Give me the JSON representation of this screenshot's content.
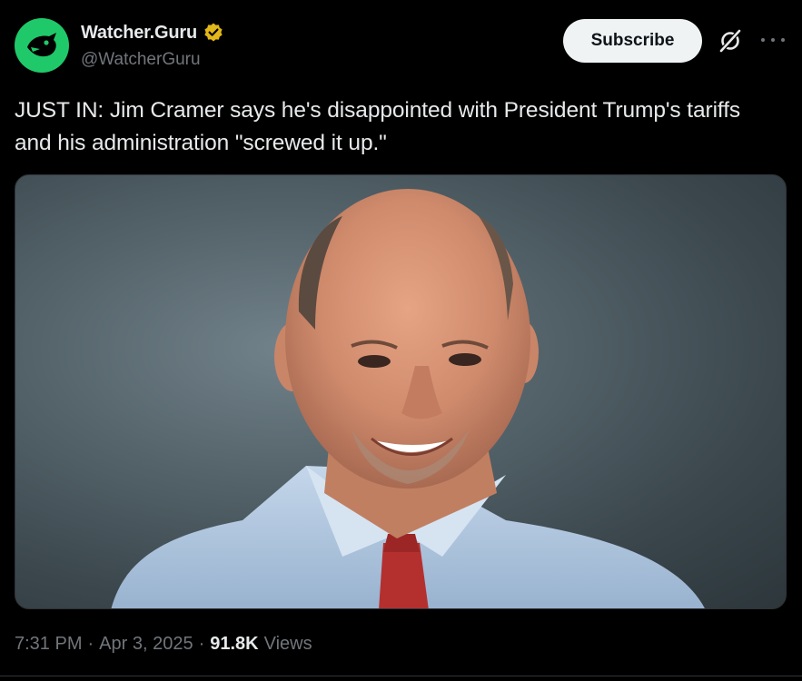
{
  "author": {
    "display_name": "Watcher.Guru",
    "handle": "@WatcherGuru",
    "avatar_icon": "watcher-guru-logo-icon",
    "avatar_color": "#1fc96a",
    "verified_badge_color": "#e2b719"
  },
  "header": {
    "subscribe_label": "Subscribe",
    "grok_icon": "grok-icon",
    "more_icon": "more-icon"
  },
  "tweet": {
    "text": "JUST IN: Jim Cramer says he's disappointed with President Trump's tariffs and his administration \"screwed it up.\""
  },
  "media": {
    "type": "photo"
  },
  "meta": {
    "time": "7:31 PM",
    "separator": "·",
    "date": "Apr 3, 2025",
    "views_count": "91.8K",
    "views_label": "Views"
  },
  "colors": {
    "background": "#000000",
    "text_primary": "#e7e9ea",
    "text_secondary": "#71767b",
    "button_bg": "#eff3f4"
  }
}
